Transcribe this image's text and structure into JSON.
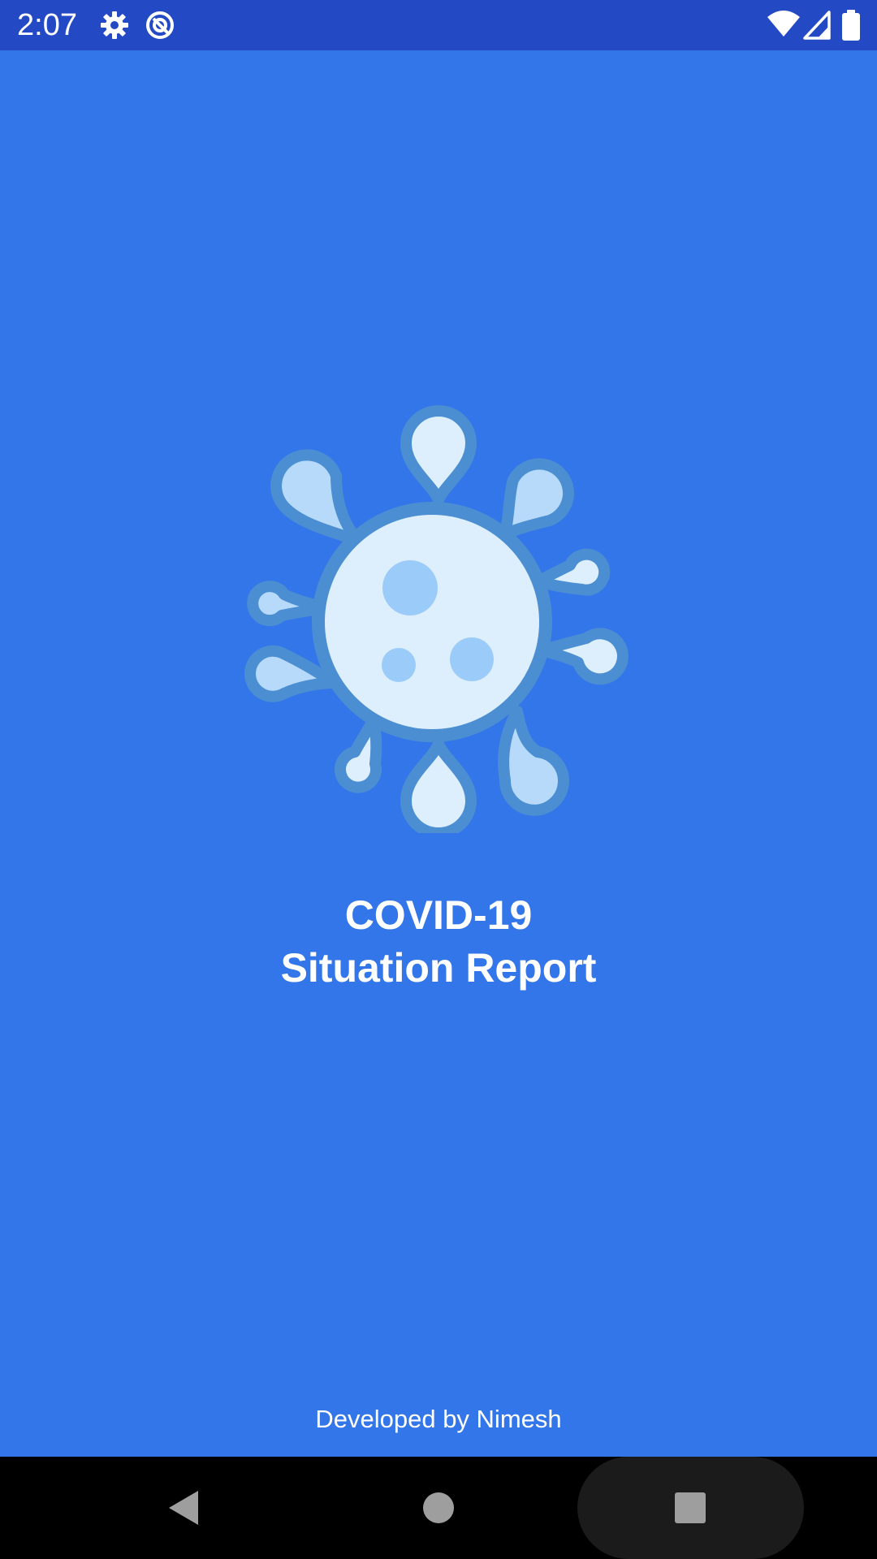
{
  "status_bar": {
    "time": "2:07",
    "left_icons": [
      "gear-icon",
      "sync-icon"
    ],
    "right_icons": [
      "wifi-icon",
      "cell-signal-icon",
      "battery-icon"
    ],
    "background": "#2449C4"
  },
  "splash": {
    "background": "#3376E9",
    "logo_icon": "virus-icon",
    "title_line_1": "COVID-19",
    "title_line_2": "Situation Report",
    "credit": "Developed by Nimesh"
  },
  "nav_bar": {
    "buttons": [
      "back-icon",
      "home-icon",
      "recents-icon"
    ]
  }
}
